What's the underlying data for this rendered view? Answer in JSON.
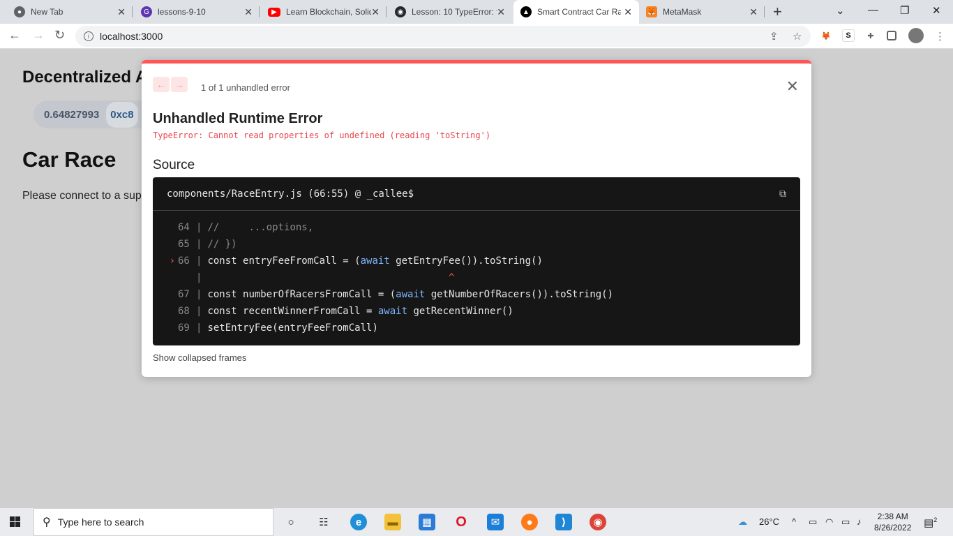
{
  "tabs": [
    {
      "title": "New Tab",
      "favicon": "chrome-icon",
      "color": "#5f6368"
    },
    {
      "title": "lessons-9-10",
      "favicon": "github-gist-icon",
      "color": "#5e35b1"
    },
    {
      "title": "Learn Blockchain, Solid",
      "favicon": "youtube-icon",
      "color": "#ff0000"
    },
    {
      "title": "Lesson: 10 TypeError: f",
      "favicon": "github-icon",
      "color": "#24292e"
    },
    {
      "title": "Smart Contract Car Ra",
      "favicon": "vercel-icon",
      "color": "#000000"
    },
    {
      "title": "MetaMask",
      "favicon": "metamask-icon",
      "color": "#f6851b"
    }
  ],
  "address_bar": {
    "url": "localhost:3000"
  },
  "page": {
    "heading": "Decentralized A",
    "balance": "0.64827993",
    "address": "0xc8",
    "subheading": "Car Race",
    "message": "Please connect to a supp"
  },
  "overlay": {
    "count_label": "1 of 1 unhandled error",
    "title": "Unhandled Runtime Error",
    "message": "TypeError: Cannot read properties of undefined (reading 'toString')",
    "source_heading": "Source",
    "file": "components/RaceEntry.js (66:55) @ _callee$",
    "lines": [
      {
        "num": "64",
        "code": "//     ...options,",
        "comment": true
      },
      {
        "num": "65",
        "code": "// })",
        "comment": true
      },
      {
        "num": "66",
        "pre": "const entryFeeFromCall = (",
        "kw": "await",
        "post": " getEntryFee()).toString()",
        "highlight": true
      },
      {
        "num": "",
        "caret": "^"
      },
      {
        "num": "67",
        "pre": "const numberOfRacersFromCall = (",
        "kw": "await",
        "post": " getNumberOfRacers()).toString()"
      },
      {
        "num": "68",
        "pre": "const recentWinnerFromCall = ",
        "kw": "await",
        "post": " getRecentWinner()"
      },
      {
        "num": "69",
        "pre": "setEntryFee(entryFeeFromCall)",
        "kw": "",
        "post": ""
      }
    ],
    "collapsed_label": "Show collapsed frames"
  },
  "taskbar": {
    "search_placeholder": "Type here to search",
    "weather": "26°C",
    "time": "2:38 AM",
    "date": "8/26/2022",
    "notifications": "2"
  }
}
